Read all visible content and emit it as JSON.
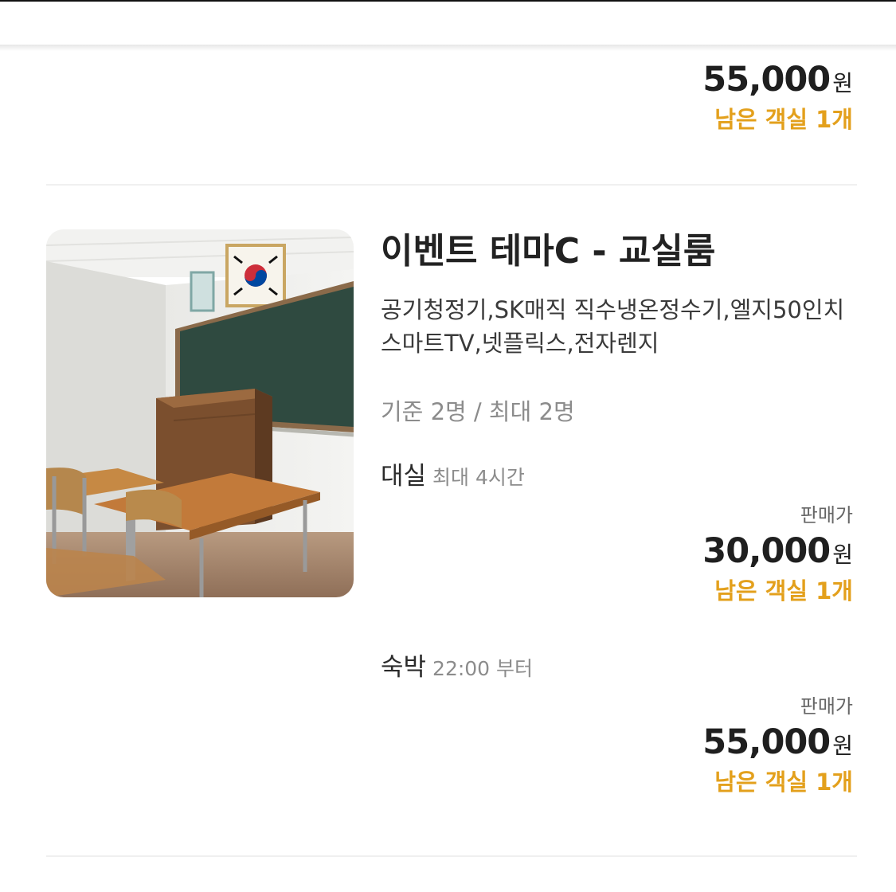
{
  "prev_room": {
    "price_amount": "55,000",
    "price_unit": "원",
    "remaining": "남은 객실 1개"
  },
  "room": {
    "title": "이벤트 테마C - 교실룸",
    "amenities": "공기청정기,SK매직 직수냉온정수기,엘지50인치스마트TV,넷플릭스,전자렌지",
    "capacity": "기준 2명 / 최대 2명",
    "rates": [
      {
        "name": "대실",
        "detail": "최대 4시간",
        "sale_label": "판매가",
        "price_amount": "30,000",
        "price_unit": "원",
        "remaining": "남은 객실 1개"
      },
      {
        "name": "숙박",
        "detail": "22:00 부터",
        "sale_label": "판매가",
        "price_amount": "55,000",
        "price_unit": "원",
        "remaining": "남은 객실 1개"
      }
    ]
  },
  "colors": {
    "accent_orange": "#e3a01c",
    "chalkboard_green": "#2f4a40",
    "desk_wood": "#c27a3a"
  }
}
